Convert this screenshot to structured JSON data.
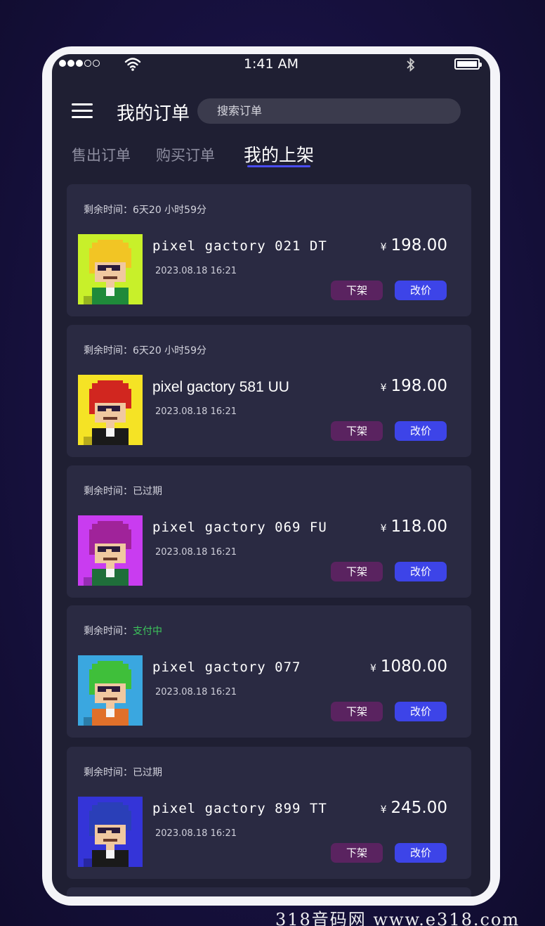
{
  "status_bar": {
    "time": "1:41 AM",
    "signal_dots_filled": 3,
    "signal_dots_total": 5
  },
  "header": {
    "title": "我的订单",
    "search_placeholder": "搜索订单"
  },
  "tabs": [
    {
      "label": "售出订单",
      "active": false
    },
    {
      "label": "购买订单",
      "active": false
    },
    {
      "label": "我的上架",
      "active": true
    }
  ],
  "listings": [
    {
      "remain_label": "剩余时间：",
      "remain_value": "6天20 小时59分",
      "status_color": "#d4d4de",
      "name": "pixel gactory 021 DT",
      "date": "2023.08.18   16:21",
      "currency": "¥",
      "price": "198.00",
      "btn_off": "下架",
      "btn_price": "改价",
      "avatar_bg": "#c8f02a",
      "avatar_hair": "#f2c524",
      "avatar_shirt": "#1f8a3a",
      "avatar": "avatar-blonde-glasses"
    },
    {
      "remain_label": "剩余时间：",
      "remain_value": "6天20 小时59分",
      "status_color": "#d4d4de",
      "name": "pixel gactory 581 UU",
      "date": "2023.08.18   16:21",
      "currency": "¥",
      "price": "198.00",
      "btn_off": "下架",
      "btn_price": "改价",
      "avatar_bg": "#f5e325",
      "avatar_hair": "#d1261f",
      "avatar_shirt": "#1a1a1a",
      "avatar": "avatar-red-hair"
    },
    {
      "remain_label": "剩余时间：",
      "remain_value": "已过期",
      "status_color": "#d4d4de",
      "name": "pixel gactory 069 FU",
      "date": "2023.08.18   16:21",
      "currency": "¥",
      "price": "118.00",
      "btn_off": "下架",
      "btn_price": "改价",
      "avatar_bg": "#c93cf0",
      "avatar_hair": "#a0239a",
      "avatar_shirt": "#1f6e3a",
      "avatar": "avatar-purple-hair"
    },
    {
      "remain_label": "剩余时间：",
      "remain_value": "支付中",
      "status_color": "#3dc85c",
      "name": "pixel gactory 077",
      "date": "2023.08.18   16:21",
      "currency": "¥",
      "price": "1080.00",
      "btn_off": "下架",
      "btn_price": "改价",
      "avatar_bg": "#3aa7e0",
      "avatar_hair": "#3fbf3a",
      "avatar_shirt": "#e0702a",
      "avatar": "avatar-green-hair"
    },
    {
      "remain_label": "剩余时间：",
      "remain_value": "已过期",
      "status_color": "#d4d4de",
      "name": "pixel gactory 899 TT",
      "date": "2023.08.18   16:21",
      "currency": "¥",
      "price": "245.00",
      "btn_off": "下架",
      "btn_price": "改价",
      "avatar_bg": "#3434d8",
      "avatar_hair": "#2a3fb8",
      "avatar_shirt": "#1a1a1a",
      "avatar": "avatar-blue-hair"
    }
  ],
  "watermark": "318音码网   www.e318.com"
}
